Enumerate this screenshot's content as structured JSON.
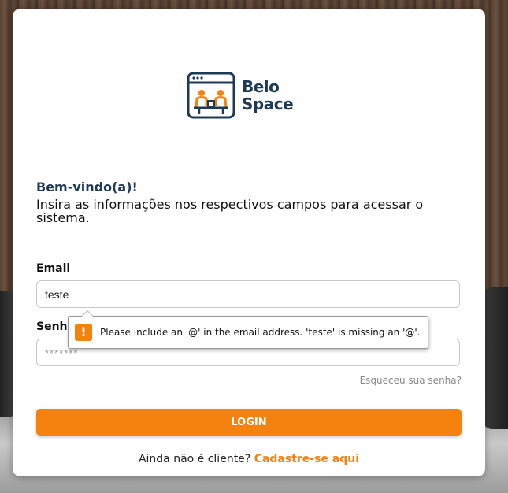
{
  "brand": {
    "name_line1": "Belo",
    "name_line2": "Space",
    "logo_icon": "coworking-window-icon",
    "primary_color": "#1e3a56",
    "accent_color": "#f5820f"
  },
  "welcome": {
    "title": "Bem-vindo(a)!",
    "description": "Insira as informações nos respectivos campos para acessar o sistema."
  },
  "form": {
    "email_label": "Email",
    "email_value": "teste",
    "password_label": "Senha",
    "password_placeholder": "*******",
    "forgot_link": "Esqueceu sua senha?",
    "login_button": "LOGIN"
  },
  "signup": {
    "prompt": "Ainda não é cliente?",
    "link": "Cadastre-se aqui"
  },
  "validation_tooltip": {
    "icon": "warning-icon",
    "message": "Please include an '@' in the email address. 'teste' is missing an '@'."
  }
}
